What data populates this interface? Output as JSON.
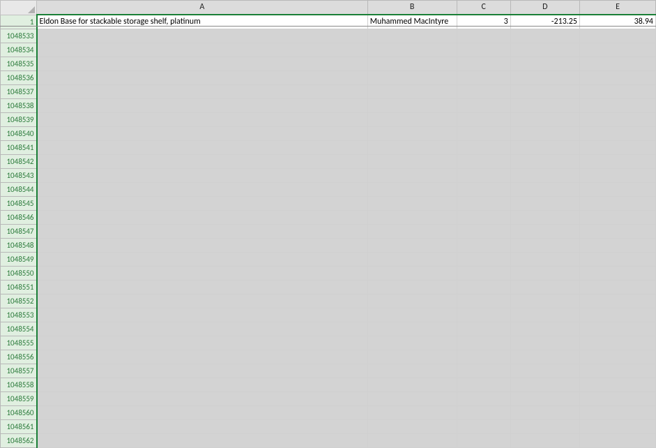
{
  "columns": [
    {
      "letter": "A",
      "class": "col-A"
    },
    {
      "letter": "B",
      "class": "col-B"
    },
    {
      "letter": "C",
      "class": "col-C"
    },
    {
      "letter": "D",
      "class": "col-D"
    },
    {
      "letter": "E",
      "class": "col-E"
    }
  ],
  "frozenRow": {
    "number": 1,
    "cells": {
      "A": "Eldon Base for stackable storage shelf, platinum",
      "B": "Muhammed MacIntyre",
      "C": "3",
      "D": "-213.25",
      "E": "38.94"
    }
  },
  "emptyRowNumbers": [
    1048533,
    1048534,
    1048535,
    1048536,
    1048537,
    1048538,
    1048539,
    1048540,
    1048541,
    1048542,
    1048543,
    1048544,
    1048545,
    1048546,
    1048547,
    1048548,
    1048549,
    1048550,
    1048551,
    1048552,
    1048553,
    1048554,
    1048555,
    1048556,
    1048557,
    1048558,
    1048559,
    1048560,
    1048561,
    1048562
  ]
}
